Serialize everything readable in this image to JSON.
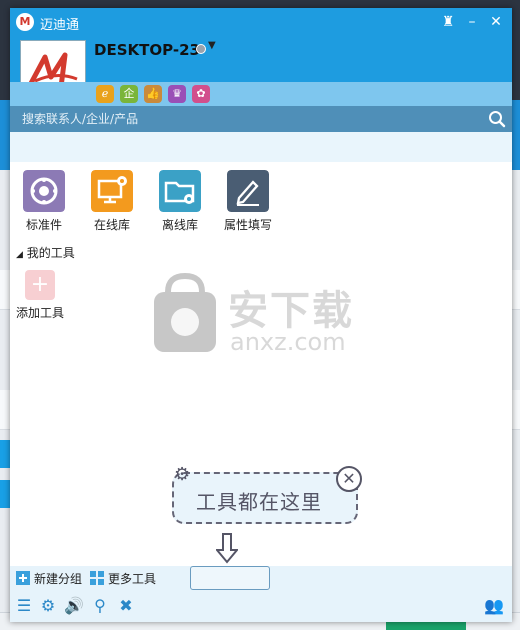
{
  "window": {
    "title": "迈迪通",
    "device_name": "DESKTOP-23"
  },
  "app_icons": [
    "ie-icon",
    "qi-icon",
    "thumb-icon",
    "crown-icon",
    "reel-icon"
  ],
  "search": {
    "placeholder": "搜索联系人/企业/产品"
  },
  "tools": [
    {
      "label": "标准件",
      "icon": "standard-parts-icon",
      "color": "#8c7ab5"
    },
    {
      "label": "在线库",
      "icon": "online-library-icon",
      "color": "#f39a1e"
    },
    {
      "label": "离线库",
      "icon": "offline-library-icon",
      "color": "#3ba1c6"
    },
    {
      "label": "属性填写",
      "icon": "property-edit-icon",
      "color": "#4a5d73"
    }
  ],
  "my_tools": {
    "heading": "我的工具",
    "add_label": "添加工具"
  },
  "hint": {
    "text": "工具都在这里"
  },
  "watermark": {
    "text": "安下载",
    "sub": "anxz.com"
  },
  "footer": {
    "new_group": "新建分组",
    "more_tools": "更多工具"
  },
  "colors": {
    "titlebar": "#1e9ce0",
    "search": "#4f8fb8",
    "accent": "#2b88c8"
  }
}
